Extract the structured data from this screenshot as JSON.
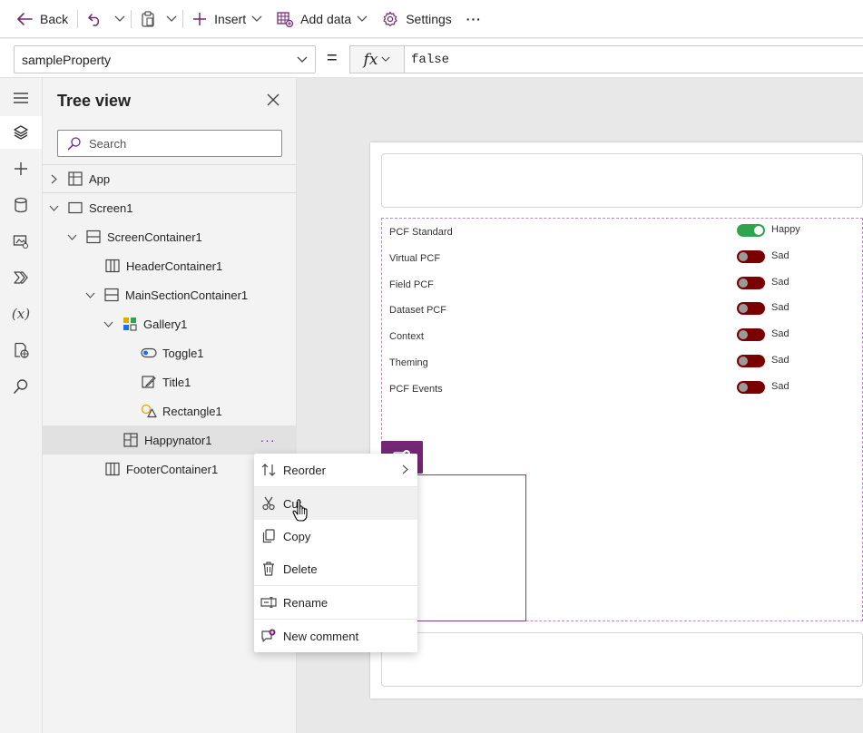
{
  "command_bar": {
    "back_label": "Back",
    "insert_label": "Insert",
    "add_data_label": "Add data",
    "settings_label": "Settings",
    "more_label": "···"
  },
  "formula_bar": {
    "property": "sampleProperty",
    "equals": "=",
    "fx_label": "fx",
    "formula": "false"
  },
  "tree_view": {
    "title": "Tree view",
    "search_placeholder": "Search",
    "app_label": "App",
    "items": {
      "screen1": "Screen1",
      "screen_container": "ScreenContainer1",
      "header_container": "HeaderContainer1",
      "main_section_container": "MainSectionContainer1",
      "gallery": "Gallery1",
      "toggle": "Toggle1",
      "title": "Title1",
      "rectangle": "Rectangle1",
      "happynator": "Happynator1",
      "footer_container": "FooterContainer1"
    },
    "more_label": "···"
  },
  "context_menu": {
    "reorder": "Reorder",
    "cut": "Cut",
    "copy": "Copy",
    "delete": "Delete",
    "rename": "Rename",
    "new_comment": "New comment"
  },
  "gallery_rows": [
    {
      "label": "PCF Standard",
      "state": "Happy",
      "on": true
    },
    {
      "label": "Virtual PCF",
      "state": "Sad",
      "on": false
    },
    {
      "label": "Field PCF",
      "state": "Sad",
      "on": false
    },
    {
      "label": "Dataset PCF",
      "state": "Sad",
      "on": false
    },
    {
      "label": "Context",
      "state": "Sad",
      "on": false
    },
    {
      "label": "Theming",
      "state": "Sad",
      "on": false
    },
    {
      "label": "PCF Events",
      "state": "Sad",
      "on": false
    }
  ],
  "colors": {
    "accent": "#742774",
    "toggle_on": "#2ea44f",
    "toggle_off": "#7a0000"
  }
}
